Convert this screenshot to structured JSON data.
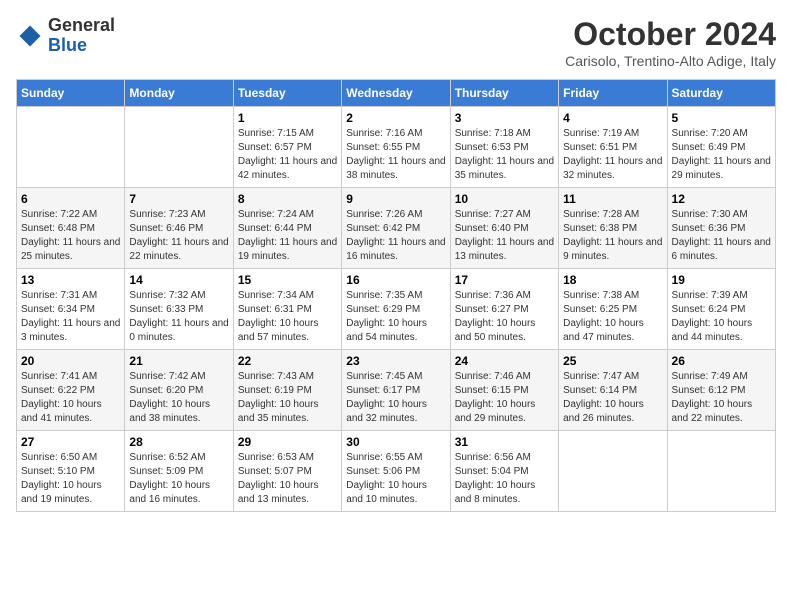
{
  "header": {
    "logo": {
      "general": "General",
      "blue": "Blue"
    },
    "title": "October 2024",
    "subtitle": "Carisolo, Trentino-Alto Adige, Italy"
  },
  "calendar": {
    "days_of_week": [
      "Sunday",
      "Monday",
      "Tuesday",
      "Wednesday",
      "Thursday",
      "Friday",
      "Saturday"
    ],
    "weeks": [
      [
        {
          "day": "",
          "info": ""
        },
        {
          "day": "",
          "info": ""
        },
        {
          "day": "1",
          "info": "Sunrise: 7:15 AM\nSunset: 6:57 PM\nDaylight: 11 hours and 42 minutes."
        },
        {
          "day": "2",
          "info": "Sunrise: 7:16 AM\nSunset: 6:55 PM\nDaylight: 11 hours and 38 minutes."
        },
        {
          "day": "3",
          "info": "Sunrise: 7:18 AM\nSunset: 6:53 PM\nDaylight: 11 hours and 35 minutes."
        },
        {
          "day": "4",
          "info": "Sunrise: 7:19 AM\nSunset: 6:51 PM\nDaylight: 11 hours and 32 minutes."
        },
        {
          "day": "5",
          "info": "Sunrise: 7:20 AM\nSunset: 6:49 PM\nDaylight: 11 hours and 29 minutes."
        }
      ],
      [
        {
          "day": "6",
          "info": "Sunrise: 7:22 AM\nSunset: 6:48 PM\nDaylight: 11 hours and 25 minutes."
        },
        {
          "day": "7",
          "info": "Sunrise: 7:23 AM\nSunset: 6:46 PM\nDaylight: 11 hours and 22 minutes."
        },
        {
          "day": "8",
          "info": "Sunrise: 7:24 AM\nSunset: 6:44 PM\nDaylight: 11 hours and 19 minutes."
        },
        {
          "day": "9",
          "info": "Sunrise: 7:26 AM\nSunset: 6:42 PM\nDaylight: 11 hours and 16 minutes."
        },
        {
          "day": "10",
          "info": "Sunrise: 7:27 AM\nSunset: 6:40 PM\nDaylight: 11 hours and 13 minutes."
        },
        {
          "day": "11",
          "info": "Sunrise: 7:28 AM\nSunset: 6:38 PM\nDaylight: 11 hours and 9 minutes."
        },
        {
          "day": "12",
          "info": "Sunrise: 7:30 AM\nSunset: 6:36 PM\nDaylight: 11 hours and 6 minutes."
        }
      ],
      [
        {
          "day": "13",
          "info": "Sunrise: 7:31 AM\nSunset: 6:34 PM\nDaylight: 11 hours and 3 minutes."
        },
        {
          "day": "14",
          "info": "Sunrise: 7:32 AM\nSunset: 6:33 PM\nDaylight: 11 hours and 0 minutes."
        },
        {
          "day": "15",
          "info": "Sunrise: 7:34 AM\nSunset: 6:31 PM\nDaylight: 10 hours and 57 minutes."
        },
        {
          "day": "16",
          "info": "Sunrise: 7:35 AM\nSunset: 6:29 PM\nDaylight: 10 hours and 54 minutes."
        },
        {
          "day": "17",
          "info": "Sunrise: 7:36 AM\nSunset: 6:27 PM\nDaylight: 10 hours and 50 minutes."
        },
        {
          "day": "18",
          "info": "Sunrise: 7:38 AM\nSunset: 6:25 PM\nDaylight: 10 hours and 47 minutes."
        },
        {
          "day": "19",
          "info": "Sunrise: 7:39 AM\nSunset: 6:24 PM\nDaylight: 10 hours and 44 minutes."
        }
      ],
      [
        {
          "day": "20",
          "info": "Sunrise: 7:41 AM\nSunset: 6:22 PM\nDaylight: 10 hours and 41 minutes."
        },
        {
          "day": "21",
          "info": "Sunrise: 7:42 AM\nSunset: 6:20 PM\nDaylight: 10 hours and 38 minutes."
        },
        {
          "day": "22",
          "info": "Sunrise: 7:43 AM\nSunset: 6:19 PM\nDaylight: 10 hours and 35 minutes."
        },
        {
          "day": "23",
          "info": "Sunrise: 7:45 AM\nSunset: 6:17 PM\nDaylight: 10 hours and 32 minutes."
        },
        {
          "day": "24",
          "info": "Sunrise: 7:46 AM\nSunset: 6:15 PM\nDaylight: 10 hours and 29 minutes."
        },
        {
          "day": "25",
          "info": "Sunrise: 7:47 AM\nSunset: 6:14 PM\nDaylight: 10 hours and 26 minutes."
        },
        {
          "day": "26",
          "info": "Sunrise: 7:49 AM\nSunset: 6:12 PM\nDaylight: 10 hours and 22 minutes."
        }
      ],
      [
        {
          "day": "27",
          "info": "Sunrise: 6:50 AM\nSunset: 5:10 PM\nDaylight: 10 hours and 19 minutes."
        },
        {
          "day": "28",
          "info": "Sunrise: 6:52 AM\nSunset: 5:09 PM\nDaylight: 10 hours and 16 minutes."
        },
        {
          "day": "29",
          "info": "Sunrise: 6:53 AM\nSunset: 5:07 PM\nDaylight: 10 hours and 13 minutes."
        },
        {
          "day": "30",
          "info": "Sunrise: 6:55 AM\nSunset: 5:06 PM\nDaylight: 10 hours and 10 minutes."
        },
        {
          "day": "31",
          "info": "Sunrise: 6:56 AM\nSunset: 5:04 PM\nDaylight: 10 hours and 8 minutes."
        },
        {
          "day": "",
          "info": ""
        },
        {
          "day": "",
          "info": ""
        }
      ]
    ]
  }
}
